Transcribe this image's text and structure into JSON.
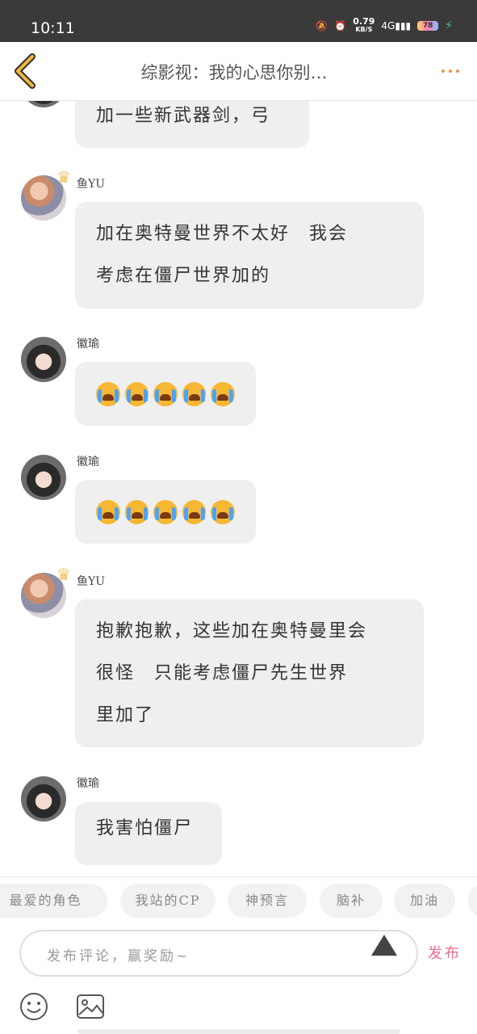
{
  "status_bar": {
    "time": "10:11",
    "speed_value": "0.79",
    "speed_unit": "KB/S",
    "network": "4G",
    "battery": "78"
  },
  "header": {
    "title": "综影视：我的心思你别…"
  },
  "messages": [
    {
      "text": "加一些新武器剑，弓"
    },
    {
      "user": "鱼YU",
      "line1": "加在奥特曼世界不太好　我会",
      "line2": "考虑在僵尸世界加的"
    },
    {
      "user": "徽瑜",
      "emoji": "crying-face x5"
    },
    {
      "user": "徽瑜",
      "emoji": "crying-face x5"
    },
    {
      "user": "鱼YU",
      "line1": "抱歉抱歉，这些加在奥特曼里会",
      "line2": "很怪　只能考虑僵尸先生世界",
      "line3": "里加了"
    },
    {
      "user": "徽瑜",
      "text": "我害怕僵尸"
    }
  ],
  "chips": [
    "最爱的角色",
    "我站的CP",
    "神预言",
    "脑补",
    "加油"
  ],
  "comment": {
    "placeholder": "发布评论，赢奖励~",
    "publish_label": "发布"
  },
  "colors": {
    "accent": "#f06a8a",
    "back": "#f2b83c",
    "more": "#f0914a"
  }
}
